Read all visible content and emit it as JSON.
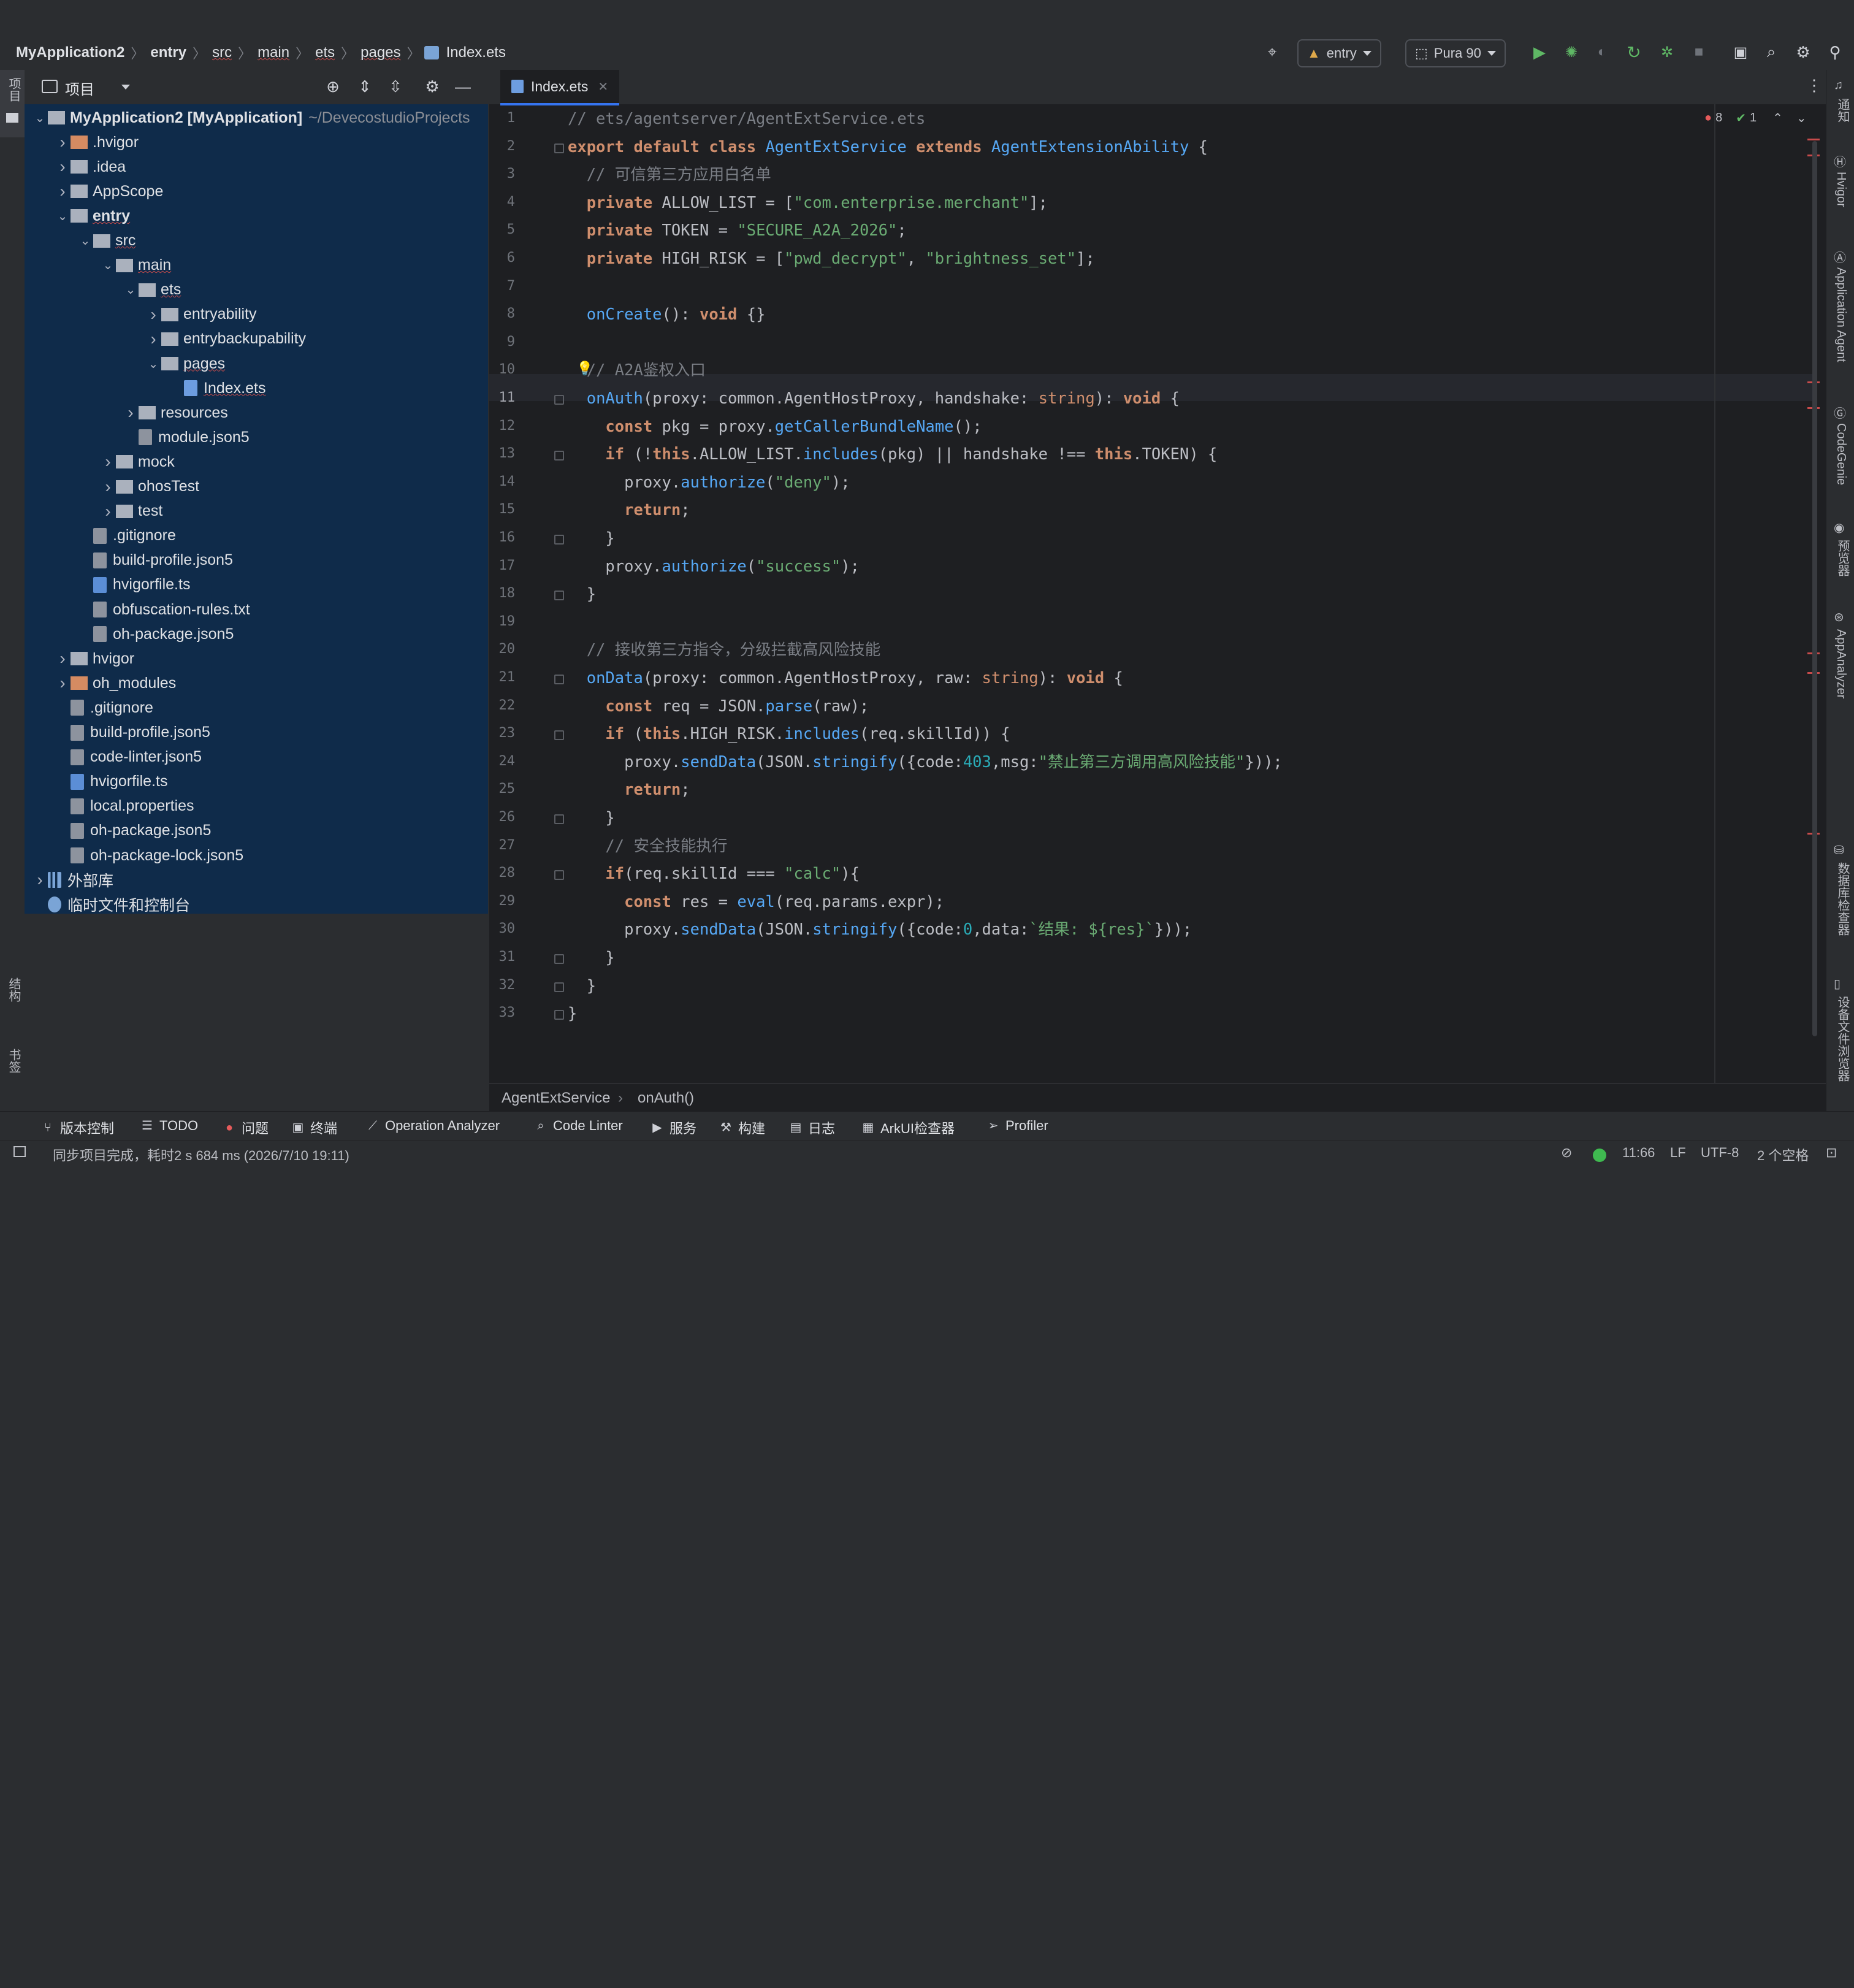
{
  "topbar": {
    "breadcrumb": [
      "MyApplication2",
      "entry",
      "src",
      "main",
      "ets",
      "pages",
      "Index.ets"
    ],
    "run_config": "entry",
    "device": "Pura 90"
  },
  "project_panel": {
    "title": "项目",
    "tree": [
      {
        "label": "MyApplication2 [MyApplication]",
        "suffix": "~/DevecostudioProjects",
        "depth": 0,
        "expanded": true,
        "icon": "module-folder"
      },
      {
        "label": ".hvigor",
        "depth": 1,
        "expanded": false,
        "icon": "folder-orange"
      },
      {
        "label": ".idea",
        "depth": 1,
        "expanded": false,
        "icon": "folder"
      },
      {
        "label": "AppScope",
        "depth": 1,
        "expanded": false,
        "icon": "folder"
      },
      {
        "label": "entry",
        "depth": 1,
        "expanded": true,
        "icon": "module-folder"
      },
      {
        "label": "src",
        "depth": 2,
        "expanded": true,
        "icon": "folder"
      },
      {
        "label": "main",
        "depth": 3,
        "expanded": true,
        "icon": "folder"
      },
      {
        "label": "ets",
        "depth": 4,
        "expanded": true,
        "icon": "folder"
      },
      {
        "label": "entryability",
        "depth": 5,
        "expanded": false,
        "icon": "folder"
      },
      {
        "label": "entrybackupability",
        "depth": 5,
        "expanded": false,
        "icon": "folder"
      },
      {
        "label": "pages",
        "depth": 5,
        "expanded": true,
        "icon": "folder"
      },
      {
        "label": "Index.ets",
        "depth": 6,
        "icon": "ets-file"
      },
      {
        "label": "resources",
        "depth": 4,
        "expanded": false,
        "icon": "folder"
      },
      {
        "label": "module.json5",
        "depth": 4,
        "icon": "json-file"
      },
      {
        "label": "mock",
        "depth": 3,
        "expanded": false,
        "icon": "folder"
      },
      {
        "label": "ohosTest",
        "depth": 3,
        "expanded": false,
        "icon": "folder"
      },
      {
        "label": "test",
        "depth": 3,
        "expanded": false,
        "icon": "folder"
      },
      {
        "label": ".gitignore",
        "depth": 2,
        "icon": "config-file"
      },
      {
        "label": "build-profile.json5",
        "depth": 2,
        "icon": "json-file"
      },
      {
        "label": "hvigorfile.ts",
        "depth": 2,
        "icon": "ts-file"
      },
      {
        "label": "obfuscation-rules.txt",
        "depth": 2,
        "icon": "text-file"
      },
      {
        "label": "oh-package.json5",
        "depth": 2,
        "icon": "json-file"
      },
      {
        "label": "hvigor",
        "depth": 1,
        "expanded": false,
        "icon": "folder"
      },
      {
        "label": "oh_modules",
        "depth": 1,
        "expanded": false,
        "icon": "folder-orange"
      },
      {
        "label": ".gitignore",
        "depth": 1,
        "icon": "config-file"
      },
      {
        "label": "build-profile.json5",
        "depth": 1,
        "icon": "json-file"
      },
      {
        "label": "code-linter.json5",
        "depth": 1,
        "icon": "json-file"
      },
      {
        "label": "hvigorfile.ts",
        "depth": 1,
        "icon": "ts-file"
      },
      {
        "label": "local.properties",
        "depth": 1,
        "icon": "properties-file"
      },
      {
        "label": "oh-package.json5",
        "depth": 1,
        "icon": "json-file"
      },
      {
        "label": "oh-package-lock.json5",
        "depth": 1,
        "icon": "json-file"
      },
      {
        "label": "外部库",
        "depth": 0,
        "expanded": false,
        "icon": "library"
      },
      {
        "label": "临时文件和控制台",
        "depth": 0,
        "icon": "scratch"
      }
    ]
  },
  "left_strip": {
    "top_label": "项目",
    "bottom_labels": [
      "结构",
      "书签"
    ]
  },
  "editor": {
    "tab": "Index.ets",
    "inspections": {
      "errors": "8",
      "ok": "1"
    },
    "current_line": 11,
    "lines": [
      "// ets/agentserver/AgentExtService.ets",
      "export default class AgentExtService extends AgentExtensionAbility {",
      "  // 可信第三方应用白名单",
      "  private ALLOW_LIST = [\"com.enterprise.merchant\"];",
      "  private TOKEN = \"SECURE_A2A_2026\";",
      "  private HIGH_RISK = [\"pwd_decrypt\", \"brightness_set\"];",
      "",
      "  onCreate(): void {}",
      "",
      "  // A2A鉴权入口",
      "  onAuth(proxy: common.AgentHostProxy, handshake: string): void {",
      "    const pkg = proxy.getCallerBundleName();",
      "    if (!this.ALLOW_LIST.includes(pkg) || handshake !== this.TOKEN) {",
      "      proxy.authorize(\"deny\");",
      "      return;",
      "    }",
      "    proxy.authorize(\"success\");",
      "  }",
      "",
      "  // 接收第三方指令，分级拦截高风险技能",
      "  onData(proxy: common.AgentHostProxy, raw: string): void {",
      "    const req = JSON.parse(raw);",
      "    if (this.HIGH_RISK.includes(req.skillId)) {",
      "      proxy.sendData(JSON.stringify({code:403,msg:\"禁止第三方调用高风险技能\"}));",
      "      return;",
      "    }",
      "    // 安全技能执行",
      "    if(req.skillId === \"calc\"){",
      "      const res = eval(req.params.expr);",
      "      proxy.sendData(JSON.stringify({code:0,data:`结果: ${res}`}));",
      "    }",
      "  }",
      "}"
    ],
    "breadcrumb": [
      "AgentExtService",
      "onAuth()"
    ]
  },
  "right_strip": [
    "通知",
    "Hvigor",
    "Application Agent",
    "CodeGenie",
    "预览器",
    "AppAnalyzer",
    "数据库检查器",
    "设备文件浏览器"
  ],
  "tool_windows": [
    {
      "label": "版本控制",
      "icon": "vcs-icon"
    },
    {
      "label": "TODO",
      "icon": "todo-icon"
    },
    {
      "label": "问题",
      "icon": "problems-icon"
    },
    {
      "label": "终端",
      "icon": "terminal-icon"
    },
    {
      "label": "Operation Analyzer",
      "icon": "analyzer-icon"
    },
    {
      "label": "Code Linter",
      "icon": "linter-icon"
    },
    {
      "label": "服务",
      "icon": "services-icon"
    },
    {
      "label": "构建",
      "icon": "build-icon"
    },
    {
      "label": "日志",
      "icon": "log-icon"
    },
    {
      "label": "ArkUI检查器",
      "icon": "inspector-icon"
    },
    {
      "label": "Profiler",
      "icon": "profiler-icon"
    }
  ],
  "status_bar": {
    "message": "同步项目完成，耗时2 s 684 ms (2026/7/10 19:11)",
    "position": "11:66",
    "line_ending": "LF",
    "encoding": "UTF-8",
    "indent": "2 个空格"
  },
  "colors": {
    "accent": "#3574f0",
    "selection": "#0f2b4a",
    "editor_bg": "#1e1f22",
    "chrome_bg": "#2b2d30"
  }
}
